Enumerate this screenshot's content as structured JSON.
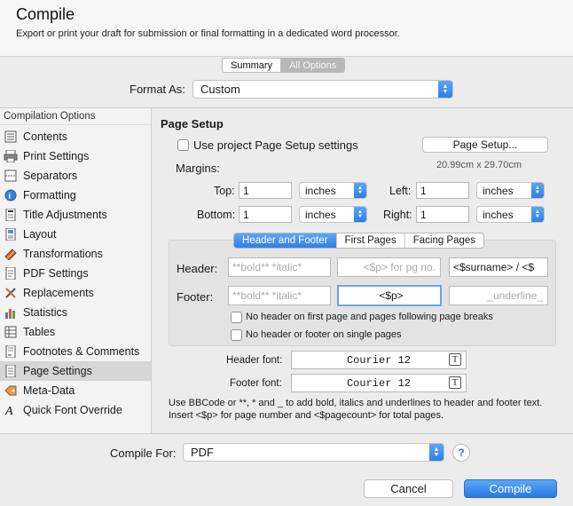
{
  "window": {
    "title": "Compile",
    "subtitle": "Export or print your draft for submission or final formatting in a dedicated word processor."
  },
  "mode_tabs": [
    "Summary",
    "All Options"
  ],
  "format_as": {
    "label": "Format As:",
    "value": "Custom"
  },
  "sidebar": {
    "heading": "Compilation Options",
    "items": [
      {
        "label": "Contents",
        "icon": "list-icon"
      },
      {
        "label": "Print Settings",
        "icon": "printer-icon"
      },
      {
        "label": "Separators",
        "icon": "separator-icon"
      },
      {
        "label": "Formatting",
        "icon": "formatting-icon"
      },
      {
        "label": "Title Adjustments",
        "icon": "title-icon"
      },
      {
        "label": "Layout",
        "icon": "layout-icon"
      },
      {
        "label": "Transformations",
        "icon": "transform-icon"
      },
      {
        "label": "PDF Settings",
        "icon": "pdf-icon"
      },
      {
        "label": "Replacements",
        "icon": "replace-icon"
      },
      {
        "label": "Statistics",
        "icon": "chart-icon"
      },
      {
        "label": "Tables",
        "icon": "table-icon"
      },
      {
        "label": "Footnotes & Comments",
        "icon": "footnote-icon"
      },
      {
        "label": "Page Settings",
        "icon": "page-icon"
      },
      {
        "label": "Meta-Data",
        "icon": "tag-icon"
      },
      {
        "label": "Quick Font Override",
        "icon": "font-icon"
      }
    ],
    "selected": "Page Settings"
  },
  "page_setup": {
    "heading": "Page Setup",
    "use_project_label": "Use project Page Setup settings",
    "page_setup_button": "Page Setup...",
    "paper_size": "20.99cm x 29.70cm",
    "margins_label": "Margins:",
    "margins": {
      "top": {
        "label": "Top:",
        "value": "1",
        "unit": "inches"
      },
      "left": {
        "label": "Left:",
        "value": "1",
        "unit": "inches"
      },
      "bottom": {
        "label": "Bottom:",
        "value": "1",
        "unit": "inches"
      },
      "right": {
        "label": "Right:",
        "value": "1",
        "unit": "inches"
      }
    }
  },
  "header_footer": {
    "tabs": [
      "Header and Footer",
      "First Pages",
      "Facing Pages"
    ],
    "active_tab": "Header and Footer",
    "header_label": "Header:",
    "footer_label": "Footer:",
    "header_fields": [
      {
        "value": "",
        "placeholder": "**bold** *italic*"
      },
      {
        "value": "",
        "placeholder": "<$p> for pg no."
      },
      {
        "value": "<$surname> / <$",
        "placeholder": ""
      }
    ],
    "footer_fields": [
      {
        "value": "",
        "placeholder": "**bold** *italic*"
      },
      {
        "value": "<$p>",
        "placeholder": ""
      },
      {
        "value": "",
        "placeholder": "_underline_"
      }
    ],
    "no_header_first": "No header on first page and pages following page breaks",
    "no_header_single": "No header or footer on single pages"
  },
  "fonts": {
    "header_label": "Header font:",
    "header_value": "Courier 12",
    "footer_label": "Footer font:",
    "footer_value": "Courier 12"
  },
  "help_text": "Use BBCode or **, * and _ to add bold, italics and underlines to header and footer text. Insert <$p> for page number and <$pagecount> for total pages.",
  "compile_for": {
    "label": "Compile For:",
    "value": "PDF"
  },
  "buttons": {
    "help": "?",
    "cancel": "Cancel",
    "compile": "Compile"
  },
  "colors": {
    "accent": "#2f7fe6",
    "sidebar_selected": "#d6d6d6"
  }
}
